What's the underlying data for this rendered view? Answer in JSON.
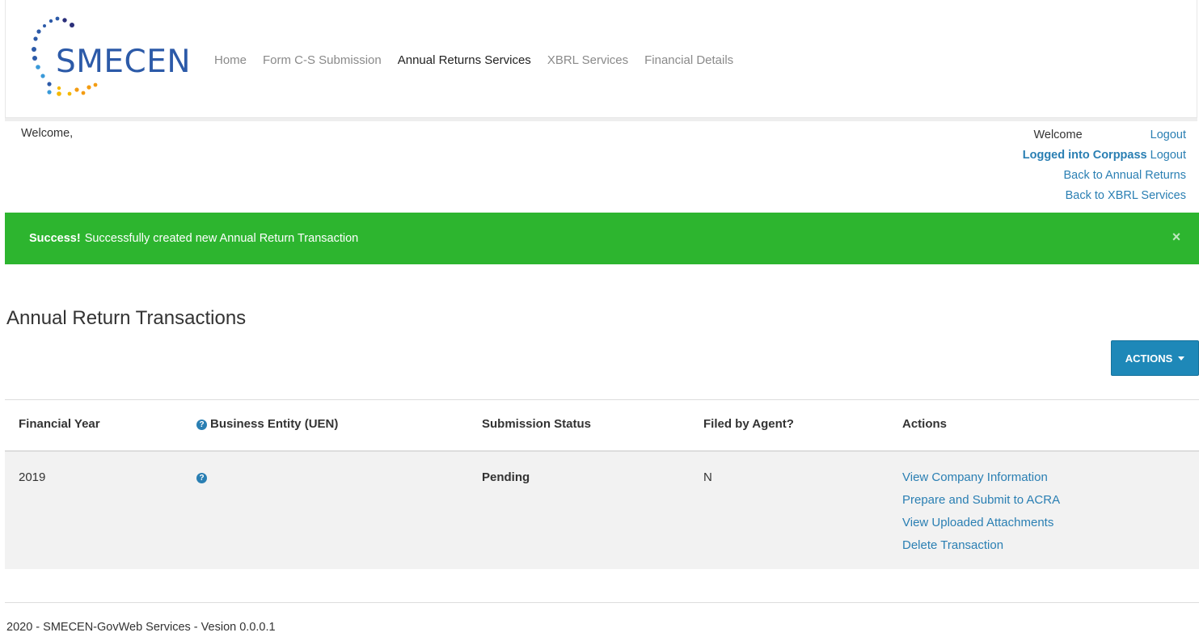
{
  "brand": {
    "name": "SMECEN",
    "colors": {
      "logo_text": "#2c5aa8",
      "dots_blue": "#2c5aa8",
      "dots_navy": "#2b2f7a",
      "dots_orange": "#f39c12",
      "dots_gold": "#f5b800"
    }
  },
  "nav": {
    "items": [
      {
        "label": "Home",
        "active": false
      },
      {
        "label": "Form C-S Submission",
        "active": false
      },
      {
        "label": "Annual Returns Services",
        "active": true
      },
      {
        "label": "XBRL Services",
        "active": false
      },
      {
        "label": "Financial Details",
        "active": false
      }
    ]
  },
  "welcome": {
    "left": "Welcome,",
    "right_label": "Welcome",
    "right_logout": "Logout",
    "corppass_label": "Logged into Corppass",
    "corppass_logout": "Logout",
    "back_annual": "Back to Annual Returns",
    "back_xbrl": "Back to XBRL Services"
  },
  "alert": {
    "strong": "Success!",
    "message": "Successfully created new Annual Return Transaction",
    "close": "×",
    "color": "#2db52f"
  },
  "page": {
    "title": "Annual Return Transactions",
    "actions_button": "ACTIONS"
  },
  "table": {
    "headers": [
      "Financial Year",
      "Business Entity (UEN)",
      "Submission Status",
      "Filed by Agent?",
      "Actions"
    ],
    "rows": [
      {
        "financial_year": "2019",
        "business_entity": "",
        "status": "Pending",
        "filed_by_agent": "N",
        "actions": [
          "View Company Information",
          "Prepare and Submit to ACRA",
          "View Uploaded Attachments",
          "Delete Transaction"
        ]
      }
    ]
  },
  "icons": {
    "help": "question-circle-icon",
    "close": "close-icon",
    "caret": "caret-down-icon"
  },
  "footer": {
    "text": "2020 - SMECEN-GovWeb Services - Vesion 0.0.0.1"
  }
}
